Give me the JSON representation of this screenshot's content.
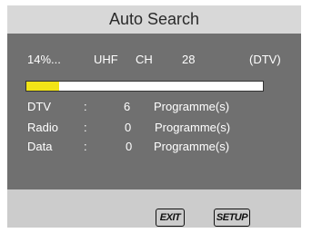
{
  "dialog": {
    "title": "Auto Search"
  },
  "status": {
    "percent_text": "14%...",
    "band": "UHF",
    "channel_label": "CH",
    "channel_number": "28",
    "signal_type": "(DTV)",
    "progress_fraction": 0.14
  },
  "counts": [
    {
      "label": "DTV",
      "separator": ":",
      "value": "6",
      "unit": "Programme(s)"
    },
    {
      "label": "Radio",
      "separator": ":",
      "value": "0",
      "unit": "Programme(s)"
    },
    {
      "label": "Data",
      "separator": ":",
      "value": "0",
      "unit": "Programme(s)"
    }
  ],
  "buttons": {
    "exit_label": "EXIT",
    "setup_label": "SETUP"
  },
  "colors": {
    "header_bg": "#d8d8d8",
    "panel_bg": "#707070",
    "footer_bg": "#cccccc",
    "progress_fill": "#f2e417",
    "progress_track": "#ffffff"
  }
}
